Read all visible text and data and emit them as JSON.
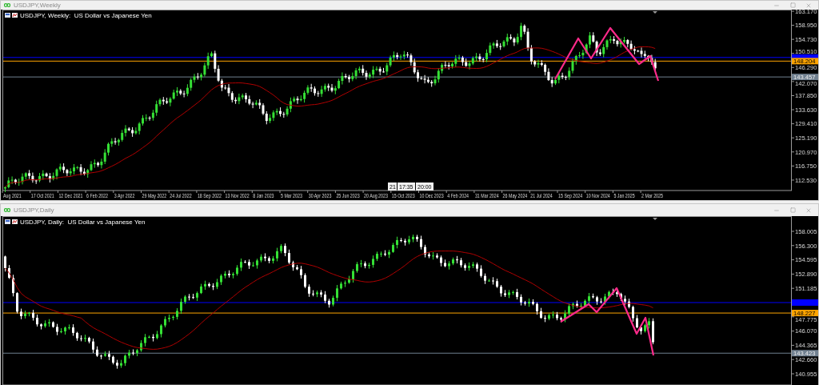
{
  "windows": [
    {
      "title": "USDJPY,Weekly",
      "legend": "USDJPY, Weekly:  US Dollar vs Japanese Yen",
      "price_labels": [
        "163.170",
        "158.950",
        "154.730",
        "150.510",
        "146.290",
        "142.070",
        "137.850",
        "133.630",
        "129.410",
        "125.190",
        "120.970",
        "116.750",
        "112.530"
      ],
      "levels": [
        {
          "color": "#0000ff"
        },
        {
          "color": "#ffa500",
          "label": "148.204"
        },
        {
          "color": "#708090",
          "label": "143.457"
        }
      ],
      "markers": [
        "21",
        "17:35",
        "20:00"
      ],
      "dates": [
        "Aug 2021",
        "17 Oct 2021",
        "12 Dec 2021",
        "6 Feb 2022",
        "3 Apr 2022",
        "29 May 2022",
        "24 Jul 2022",
        "18 Sep 2022",
        "13 Nov 2022",
        "8 Jan 2023",
        "5 Mar 2023",
        "30 Apr 2023",
        "25 Jun 2023",
        "20 Aug 2023",
        "15 Oct 2023",
        "10 Dec 2023",
        "4 Feb 2024",
        "31 Mar 2024",
        "26 May 2024",
        "21 Jul 2024",
        "15 Sep 2024",
        "10 Nov 2024",
        "5 Jan 2025",
        "2 Mar 2025"
      ]
    },
    {
      "title": "USDJPY,Daily",
      "legend": "USDJPY, Daily:  US Dollar vs Japanese Yen",
      "price_labels": [
        "158.005",
        "156.300",
        "154.595",
        "152.890",
        "151.185",
        "147.775",
        "146.070",
        "144.365",
        "142.660",
        "140.955"
      ],
      "levels": [
        {
          "color": "#0000ff"
        },
        {
          "color": "#ffa500",
          "label": "148.227"
        },
        {
          "color": "#708090",
          "label": "143.423"
        }
      ]
    }
  ]
}
